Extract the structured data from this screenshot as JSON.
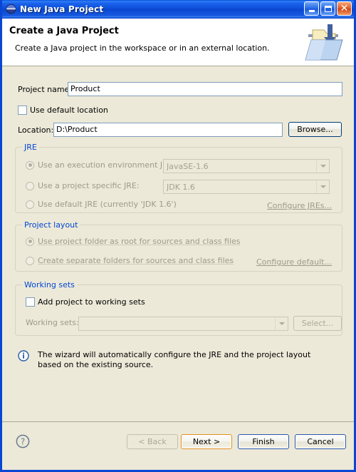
{
  "window": {
    "title": "New Java Project",
    "icon": "eclipse-globe-icon",
    "controls": {
      "minimize": "Minimize",
      "maximize": "Maximize",
      "close": "Close"
    }
  },
  "banner": {
    "title": "Create a Java Project",
    "subtitle": "Create a Java project in the workspace or in an external location.",
    "icon": "java-project-folder-icon"
  },
  "form": {
    "project_name_label": "Project name:",
    "project_name_value": "Product",
    "use_default_location_label": "Use default location",
    "use_default_location_checked": false,
    "location_label": "Location:",
    "location_value": "D:\\Product",
    "browse_label": "Browse..."
  },
  "jre": {
    "group_label": "JRE",
    "options": [
      {
        "label": "Use an execution environment JRE:",
        "selected": true,
        "combo_value": "JavaSE-1.6"
      },
      {
        "label": "Use a project specific JRE:",
        "selected": false,
        "combo_value": "JDK 1.6"
      },
      {
        "label": "Use default JRE (currently 'JDK 1.6')",
        "selected": false,
        "combo_value": ""
      }
    ],
    "configure_link": "Configure JREs..."
  },
  "project_layout": {
    "group_label": "Project layout",
    "options": [
      {
        "label": "Use project folder as root for sources and class files",
        "selected": true
      },
      {
        "label": "Create separate folders for sources and class files",
        "selected": false
      }
    ],
    "configure_link": "Configure default..."
  },
  "working_sets": {
    "group_label": "Working sets",
    "add_label": "Add project to working sets",
    "add_checked": false,
    "sets_label": "Working sets:",
    "sets_value": "",
    "select_label": "Select..."
  },
  "info": {
    "icon": "info-icon",
    "text": "The wizard will automatically configure the JRE and the project layout based on the existing source."
  },
  "footer": {
    "help_icon": "help-question-icon",
    "back_label": "< Back",
    "next_label": "Next >",
    "finish_label": "Finish",
    "cancel_label": "Cancel"
  },
  "colors": {
    "dialog_bg": "#ece9d8",
    "titlebar_blue": "#0a46d2",
    "group_label_blue": "#0046d5",
    "field_border": "#7f9db9",
    "focus_orange": "#e09020",
    "default_button_blue": "#2a58a8"
  }
}
